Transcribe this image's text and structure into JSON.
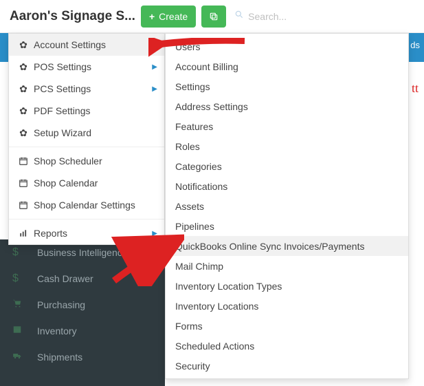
{
  "app_title": "Aaron's Signage S...",
  "topbar": {
    "create_label": "Create",
    "search_placeholder": "Search..."
  },
  "blue_strip_tag": "ds",
  "red_partial": "tt",
  "menu": {
    "items": [
      {
        "label": "Account Settings",
        "icon": "gear",
        "active": true
      },
      {
        "label": "POS Settings",
        "icon": "gear",
        "caret": true
      },
      {
        "label": "PCS Settings",
        "icon": "gear",
        "caret": true
      },
      {
        "label": "PDF Settings",
        "icon": "gear"
      },
      {
        "label": "Setup Wizard",
        "icon": "gear"
      }
    ],
    "group2": [
      {
        "label": "Shop Scheduler",
        "icon": "calendar"
      },
      {
        "label": "Shop Calendar",
        "icon": "calendar"
      },
      {
        "label": "Shop Calendar Settings",
        "icon": "calendar"
      }
    ],
    "group3": [
      {
        "label": "Reports",
        "icon": "chart",
        "caret": true
      }
    ]
  },
  "submenu": [
    "Users",
    "Account Billing",
    "Settings",
    "Address Settings",
    "Features",
    "Roles",
    "Categories",
    "Notifications",
    "Assets",
    "Pipelines",
    "QuickBooks Online Sync Invoices/Payments",
    "Mail Chimp",
    "Inventory Location Types",
    "Inventory Locations",
    "Forms",
    "Scheduled Actions",
    "Security"
  ],
  "submenu_hover_index": 10,
  "sidebar": [
    {
      "label": "Business Intelligence",
      "icon": "dollar"
    },
    {
      "label": "Cash Drawer",
      "icon": "dollar"
    },
    {
      "label": "Purchasing",
      "icon": "cart"
    },
    {
      "label": "Inventory",
      "icon": "box"
    },
    {
      "label": "Shipments",
      "icon": "truck"
    }
  ]
}
